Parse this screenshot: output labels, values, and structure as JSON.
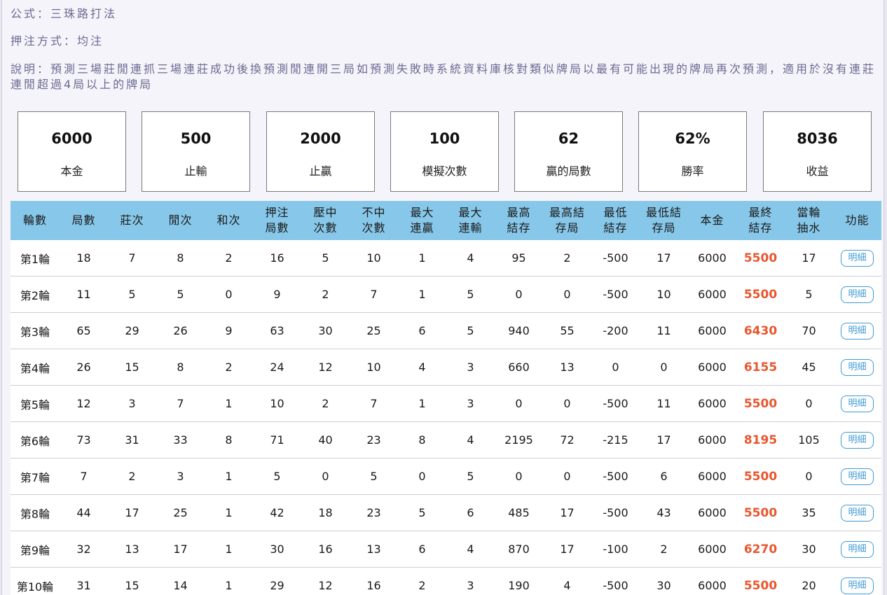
{
  "info": {
    "formula_label": "公式：",
    "formula_value": "三珠路打法",
    "bet_label": "押注方式：",
    "bet_value": "均注",
    "desc_label": "說明：",
    "desc_value": "預測三場莊閒連抓三場連莊成功後換預測閒連開三局如預測失敗時系統資料庫核對類似牌局以最有可能出現的牌局再次預測，適用於沒有連莊連閒超過4局以上的牌局"
  },
  "stats": [
    {
      "value": "6000",
      "label": "本金"
    },
    {
      "value": "500",
      "label": "止輸"
    },
    {
      "value": "2000",
      "label": "止贏"
    },
    {
      "value": "100",
      "label": "模擬次數"
    },
    {
      "value": "62",
      "label": "贏的局數"
    },
    {
      "value": "62%",
      "label": "勝率"
    },
    {
      "value": "8036",
      "label": "收益"
    }
  ],
  "table": {
    "headers": [
      {
        "l1": "輪數",
        "l2": ""
      },
      {
        "l1": "局數",
        "l2": ""
      },
      {
        "l1": "莊次",
        "l2": ""
      },
      {
        "l1": "閒次",
        "l2": ""
      },
      {
        "l1": "和次",
        "l2": ""
      },
      {
        "l1": "押注",
        "l2": "局數"
      },
      {
        "l1": "壓中",
        "l2": "次數"
      },
      {
        "l1": "不中",
        "l2": "次數"
      },
      {
        "l1": "最大",
        "l2": "連贏"
      },
      {
        "l1": "最大",
        "l2": "連輸"
      },
      {
        "l1": "最高",
        "l2": "結存"
      },
      {
        "l1": "最高結",
        "l2": "存局"
      },
      {
        "l1": "最低",
        "l2": "結存"
      },
      {
        "l1": "最低結",
        "l2": "存局"
      },
      {
        "l1": "本金",
        "l2": ""
      },
      {
        "l1": "最終",
        "l2": "結存"
      },
      {
        "l1": "當輪",
        "l2": "抽水"
      },
      {
        "l1": "功能",
        "l2": ""
      }
    ],
    "detail_label": "明細",
    "rows": [
      [
        "第1輪",
        "18",
        "7",
        "8",
        "2",
        "16",
        "5",
        "10",
        "1",
        "4",
        "95",
        "2",
        "-500",
        "17",
        "6000",
        "5500",
        "17"
      ],
      [
        "第2輪",
        "11",
        "5",
        "5",
        "0",
        "9",
        "2",
        "7",
        "1",
        "5",
        "0",
        "0",
        "-500",
        "10",
        "6000",
        "5500",
        "5"
      ],
      [
        "第3輪",
        "65",
        "29",
        "26",
        "9",
        "63",
        "30",
        "25",
        "6",
        "5",
        "940",
        "55",
        "-200",
        "11",
        "6000",
        "6430",
        "70"
      ],
      [
        "第4輪",
        "26",
        "15",
        "8",
        "2",
        "24",
        "12",
        "10",
        "4",
        "3",
        "660",
        "13",
        "0",
        "0",
        "6000",
        "6155",
        "45"
      ],
      [
        "第5輪",
        "12",
        "3",
        "7",
        "1",
        "10",
        "2",
        "7",
        "1",
        "3",
        "0",
        "0",
        "-500",
        "11",
        "6000",
        "5500",
        "0"
      ],
      [
        "第6輪",
        "73",
        "31",
        "33",
        "8",
        "71",
        "40",
        "23",
        "8",
        "4",
        "2195",
        "72",
        "-215",
        "17",
        "6000",
        "8195",
        "105"
      ],
      [
        "第7輪",
        "7",
        "2",
        "3",
        "1",
        "5",
        "0",
        "5",
        "0",
        "5",
        "0",
        "0",
        "-500",
        "6",
        "6000",
        "5500",
        "0"
      ],
      [
        "第8輪",
        "44",
        "17",
        "25",
        "1",
        "42",
        "18",
        "23",
        "5",
        "6",
        "485",
        "17",
        "-500",
        "43",
        "6000",
        "5500",
        "35"
      ],
      [
        "第9輪",
        "32",
        "13",
        "17",
        "1",
        "30",
        "16",
        "13",
        "6",
        "4",
        "870",
        "17",
        "-100",
        "2",
        "6000",
        "6270",
        "30"
      ],
      [
        "第10輪",
        "31",
        "15",
        "14",
        "1",
        "29",
        "12",
        "16",
        "2",
        "3",
        "190",
        "4",
        "-500",
        "30",
        "6000",
        "5500",
        "20"
      ]
    ]
  },
  "colors": {
    "header_bg": "#87c7e9",
    "final_balance": "#e8562e",
    "button_border": "#3f9ad3",
    "info_text": "#6c6a92"
  }
}
